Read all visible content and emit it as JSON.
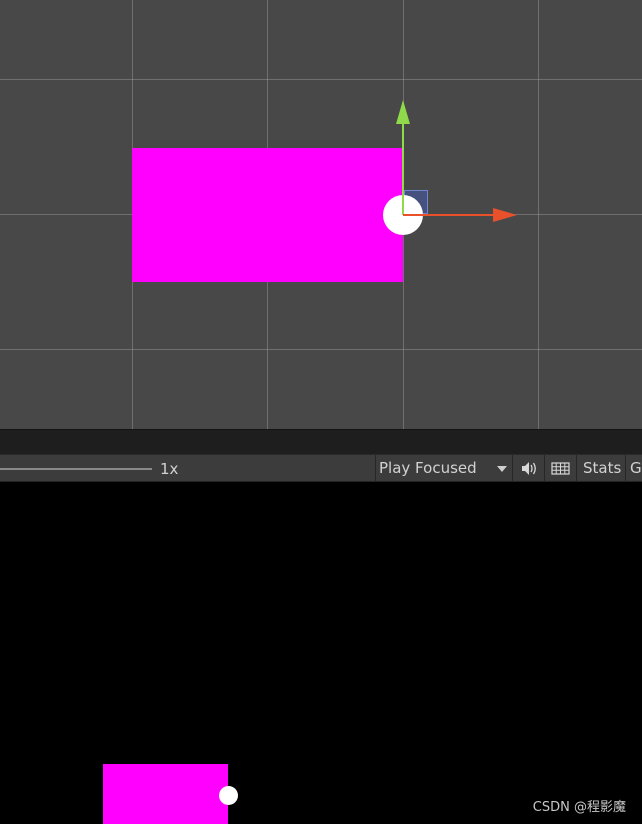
{
  "scene_view": {
    "colors": {
      "background": "#484848",
      "sprite": "#ff00ff",
      "grid": "#a0a0a0",
      "x_axis": "#e8512a",
      "y_axis": "#8fd94a",
      "handle": "#ffffff"
    },
    "icons": [
      "move-tool-x-arrow-icon",
      "move-tool-y-arrow-icon",
      "rect-handle-icon",
      "pivot-circle-icon"
    ]
  },
  "game_toolbar": {
    "scale_label": "1x",
    "play_mode_label": "Play Focused",
    "mute_icon": "speaker-icon",
    "display_icon": "keyboard-icon",
    "stats_label": "Stats",
    "gizmos_label": "G"
  },
  "game_view": {
    "colors": {
      "background": "#000000",
      "sprite": "#ff00ff",
      "circle": "#ffffff"
    }
  },
  "watermark": "CSDN @程影魔"
}
